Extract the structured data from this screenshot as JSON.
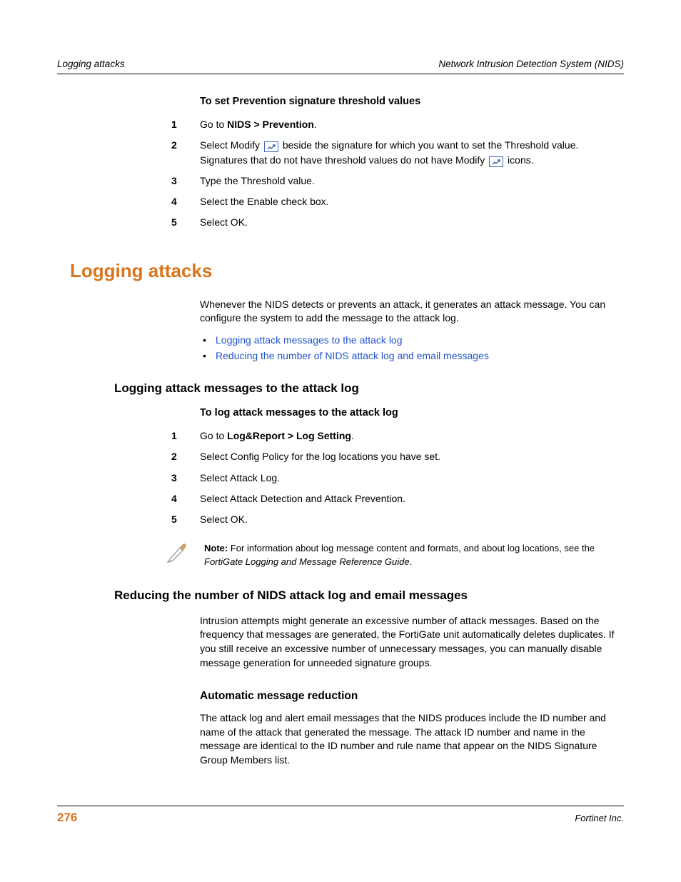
{
  "header": {
    "left": "Logging attacks",
    "right": "Network Intrusion Detection System (NIDS)"
  },
  "proc1": {
    "title": "To set Prevention signature threshold values",
    "steps": {
      "s1_pre": "Go to ",
      "s1_bold": "NIDS > Prevention",
      "s1_post": ".",
      "s2_a": "Select Modify ",
      "s2_b": " beside the signature for which you want to set the Threshold value. Signatures that do not have threshold values do not have Modify ",
      "s2_c": " icons.",
      "s3": "Type the Threshold value.",
      "s4": "Select the Enable check box.",
      "s5": "Select OK."
    }
  },
  "h1": "Logging attacks",
  "intro_para": "Whenever the NIDS detects or prevents an attack, it generates an attack message. You can configure the system to add the message to the attack log.",
  "links": {
    "l1": "Logging attack messages to the attack log",
    "l2": "Reducing the number of NIDS attack log and email messages"
  },
  "h2a": "Logging attack messages to the attack log",
  "proc2": {
    "title": "To log attack messages to the attack log",
    "steps": {
      "s1_pre": "Go to ",
      "s1_bold": "Log&Report > Log Setting",
      "s1_post": ".",
      "s2": "Select Config Policy for the log locations you have set.",
      "s3": "Select Attack Log.",
      "s4": "Select Attack Detection and Attack Prevention.",
      "s5": "Select OK."
    }
  },
  "note": {
    "label": "Note:",
    "body": " For information about log message content and formats, and about log locations, see the ",
    "ital": "FortiGate Logging and Message Reference Guide",
    "post": "."
  },
  "h2b": "Reducing the number of NIDS attack log and email messages",
  "para_b": "Intrusion attempts might generate an excessive number of attack messages. Based on the frequency that messages are generated, the FortiGate unit automatically deletes duplicates. If you still receive an excessive number of unnecessary messages, you can manually disable message generation for unneeded signature groups.",
  "h3": "Automatic message reduction",
  "para_c": "The attack log and alert email messages that the NIDS produces include the ID number and name of the attack that generated the message. The attack ID number and name in the message are identical to the ID number and rule name that appear on the NIDS Signature Group Members list.",
  "footer": {
    "page": "276",
    "company": "Fortinet Inc."
  }
}
